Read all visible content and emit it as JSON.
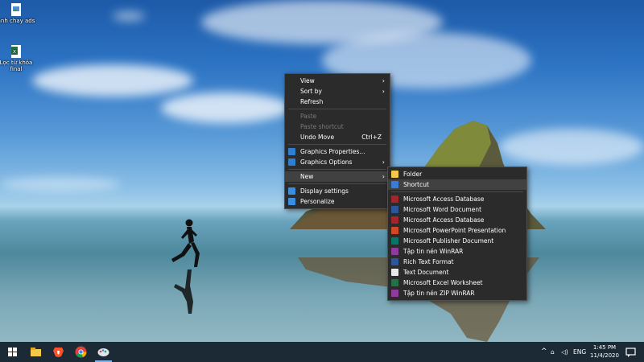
{
  "desktop": {
    "icons": [
      {
        "label": "anh chay ads",
        "icon": "image-file-icon"
      },
      {
        "label": "Lọc từ khóa final",
        "icon": "excel-file-icon"
      }
    ]
  },
  "context_menu": {
    "items": [
      {
        "label": "View",
        "submenu": true
      },
      {
        "label": "Sort by",
        "submenu": true
      },
      {
        "label": "Refresh"
      },
      {
        "label": "Paste",
        "disabled": true
      },
      {
        "label": "Paste shortcut",
        "disabled": true
      },
      {
        "label": "Undo Move",
        "shortcut": "Ctrl+Z"
      },
      {
        "label": "Graphics Properties...",
        "icon": "intel-graphics-icon"
      },
      {
        "label": "Graphics Options",
        "icon": "intel-graphics-icon",
        "submenu": true
      },
      {
        "label": "New",
        "submenu": true,
        "highlighted": true
      },
      {
        "label": "Display settings",
        "icon": "display-icon"
      },
      {
        "label": "Personalize",
        "icon": "personalize-icon"
      }
    ]
  },
  "new_submenu": {
    "items": [
      {
        "label": "Folder",
        "icon": "folder-icon",
        "color": "#f5c84a"
      },
      {
        "label": "Shortcut",
        "icon": "shortcut-icon",
        "color": "#3a7bd5",
        "highlighted": true
      },
      {
        "label": "Microsoft Access Database",
        "icon": "access-icon",
        "color": "#a4262c"
      },
      {
        "label": "Microsoft Word Document",
        "icon": "word-icon",
        "color": "#2b579a"
      },
      {
        "label": "Microsoft Access Database",
        "icon": "access-icon",
        "color": "#a4262c"
      },
      {
        "label": "Microsoft PowerPoint Presentation",
        "icon": "powerpoint-icon",
        "color": "#d24726"
      },
      {
        "label": "Microsoft Publisher Document",
        "icon": "publisher-icon",
        "color": "#077568"
      },
      {
        "label": "Tập tin nén WinRAR",
        "icon": "winrar-icon",
        "color": "#8e3b9c"
      },
      {
        "label": "Rich Text Format",
        "icon": "rtf-icon",
        "color": "#2b579a"
      },
      {
        "label": "Text Document",
        "icon": "text-document-icon",
        "color": "#e8e8e8"
      },
      {
        "label": "Microsoft Excel Worksheet",
        "icon": "excel-icon",
        "color": "#217346"
      },
      {
        "label": "Tập tin nén ZIP WinRAR",
        "icon": "winrar-zip-icon",
        "color": "#8e3b9c"
      }
    ]
  },
  "taskbar": {
    "apps": [
      "file-explorer-icon",
      "brave-browser-icon",
      "chrome-icon",
      "paint-icon"
    ],
    "tray": {
      "language": "ENG",
      "time": "1:45 PM",
      "date": "11/4/2020"
    }
  }
}
